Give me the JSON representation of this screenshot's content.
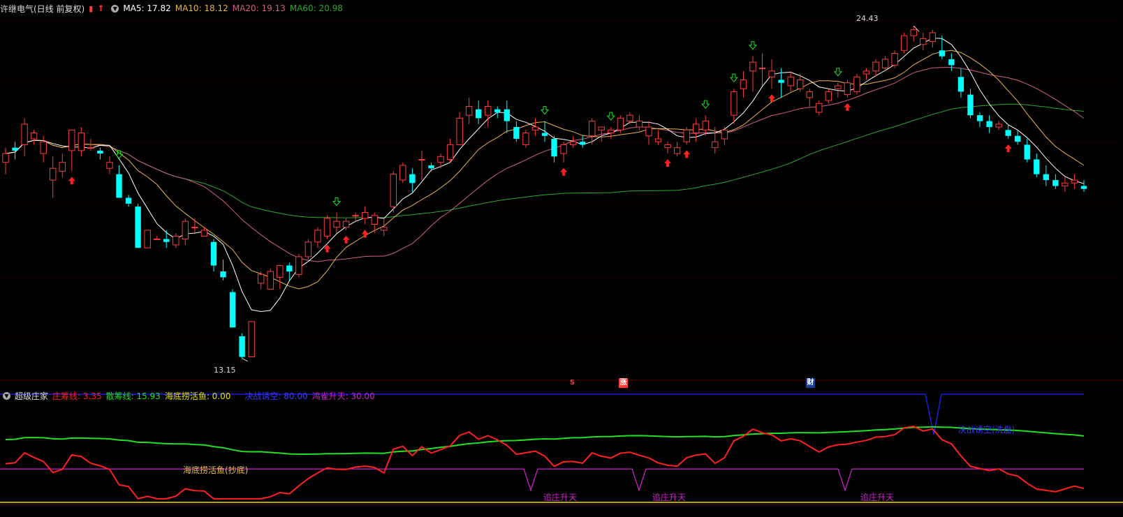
{
  "stock_header": {
    "title": "许继电气(日线 前复权)",
    "ma5": "MA5: 17.82",
    "ma10": "MA10: 18.12",
    "ma20": "MA20: 19.13",
    "ma60": "MA60: 20.98"
  },
  "indicator_header": {
    "name": "超级庄家",
    "zhuang": "庄筹线: 3.35",
    "san": "散筹线: 15.93",
    "haidi": "海底捞活鱼: 0.00",
    "juezhan": "决战诱空: 80.00",
    "hongque": "鸿雀升天: 30.00"
  },
  "markers": {
    "s": "S",
    "zhang": "涨",
    "cai": "财"
  },
  "annotations": {
    "high_label": "24.43",
    "low_label": "13.15",
    "haidi_text": "海底捞活鱼(抄底)",
    "juezhan_text": "决战诱空(洗盘)",
    "zhuiz_text": "追庄升天"
  },
  "colors": {
    "up": "#ff3b3b",
    "down": "#00ffff",
    "ma5": "#ffffff",
    "ma10": "#e7b54a",
    "ma20": "#d0608a",
    "ma60": "#2aa82a",
    "zhuang": "#ff2020",
    "san": "#22e022",
    "haidi": "#e8e000",
    "juezhan": "#2020ff",
    "hongque": "#cc22cc"
  },
  "chart_data": {
    "type": "candlestick",
    "high": 24.43,
    "low": 13.15,
    "ohlc": [
      [
        19.8,
        20.3,
        19.4,
        20.1
      ],
      [
        20.3,
        20.5,
        19.9,
        20.2
      ],
      [
        20.4,
        21.3,
        20.0,
        21.1
      ],
      [
        20.6,
        20.9,
        20.4,
        20.8
      ],
      [
        20.1,
        20.7,
        19.8,
        20.5
      ],
      [
        19.2,
        20.0,
        18.6,
        19.6
      ],
      [
        19.5,
        20.1,
        19.3,
        19.8
      ],
      [
        20.2,
        20.9,
        19.5,
        20.9
      ],
      [
        20.2,
        21.0,
        20.0,
        20.8
      ],
      [
        20.3,
        20.6,
        20.2,
        20.3
      ],
      [
        20.2,
        20.3,
        19.9,
        20.1
      ],
      [
        19.6,
        20.0,
        19.4,
        19.8
      ],
      [
        19.4,
        19.7,
        18.6,
        18.6
      ],
      [
        18.6,
        18.7,
        18.3,
        18.4
      ],
      [
        18.3,
        18.4,
        16.9,
        16.9
      ],
      [
        16.9,
        17.5,
        16.9,
        17.5
      ],
      [
        17.2,
        17.3,
        17.2,
        17.2
      ],
      [
        17.2,
        17.5,
        16.9,
        17.1
      ],
      [
        17.0,
        17.4,
        16.9,
        17.3
      ],
      [
        17.2,
        17.9,
        17.0,
        17.8
      ],
      [
        17.6,
        17.9,
        17.4,
        17.6
      ],
      [
        17.3,
        17.6,
        17.3,
        17.5
      ],
      [
        17.1,
        17.2,
        16.1,
        16.3
      ],
      [
        16.1,
        16.5,
        15.8,
        15.9
      ],
      [
        15.4,
        15.5,
        14.2,
        14.2
      ],
      [
        13.9,
        14.0,
        13.15,
        13.2
      ],
      [
        13.2,
        14.4,
        13.2,
        14.4
      ],
      [
        15.7,
        16.1,
        15.5,
        16.0
      ],
      [
        15.5,
        16.2,
        15.5,
        16.1
      ],
      [
        15.9,
        16.3,
        15.5,
        16.3
      ],
      [
        16.3,
        16.4,
        15.8,
        16.1
      ],
      [
        16.0,
        16.7,
        15.9,
        16.6
      ],
      [
        16.6,
        17.2,
        16.5,
        17.1
      ],
      [
        17.1,
        17.6,
        16.9,
        17.5
      ],
      [
        17.3,
        18.0,
        17.2,
        17.9
      ],
      [
        17.6,
        18.1,
        17.4,
        17.8
      ],
      [
        17.6,
        17.9,
        17.5,
        17.8
      ],
      [
        18.0,
        18.1,
        17.8,
        18.0
      ],
      [
        17.9,
        18.3,
        17.7,
        18.1
      ],
      [
        17.7,
        18.1,
        17.4,
        18.0
      ],
      [
        17.5,
        17.9,
        17.3,
        17.6
      ],
      [
        18.3,
        19.5,
        18.1,
        19.4
      ],
      [
        19.2,
        19.8,
        19.1,
        19.7
      ],
      [
        19.4,
        19.6,
        18.8,
        19.1
      ],
      [
        19.9,
        20.2,
        19.2,
        19.9
      ],
      [
        19.7,
        19.8,
        19.5,
        19.6
      ],
      [
        19.8,
        20.1,
        19.6,
        20.0
      ],
      [
        19.9,
        20.6,
        19.8,
        20.4
      ],
      [
        20.4,
        21.5,
        20.4,
        21.3
      ],
      [
        21.4,
        22.0,
        21.1,
        21.7
      ],
      [
        21.6,
        21.9,
        21.1,
        21.3
      ],
      [
        21.4,
        21.9,
        21.0,
        21.7
      ],
      [
        21.6,
        21.7,
        21.3,
        21.5
      ],
      [
        21.6,
        21.9,
        20.8,
        21.2
      ],
      [
        21.0,
        21.2,
        20.5,
        20.6
      ],
      [
        20.4,
        20.9,
        20.3,
        20.8
      ],
      [
        20.9,
        21.3,
        20.7,
        21.0
      ],
      [
        20.8,
        21.2,
        20.5,
        20.7
      ],
      [
        20.6,
        20.7,
        19.8,
        20.0
      ],
      [
        20.1,
        20.5,
        19.8,
        20.4
      ],
      [
        20.4,
        20.7,
        20.3,
        20.5
      ],
      [
        20.5,
        20.7,
        20.3,
        20.4
      ],
      [
        20.7,
        21.3,
        20.4,
        21.2
      ],
      [
        20.9,
        21.0,
        20.5,
        21.0
      ],
      [
        20.8,
        21.0,
        20.6,
        20.9
      ],
      [
        20.9,
        21.4,
        20.8,
        21.3
      ],
      [
        21.2,
        21.5,
        21.1,
        21.4
      ],
      [
        21.0,
        21.4,
        20.9,
        21.2
      ],
      [
        20.7,
        21.2,
        20.4,
        21.0
      ],
      [
        20.5,
        20.9,
        20.4,
        20.6
      ],
      [
        20.3,
        20.5,
        20.1,
        20.4
      ],
      [
        20.1,
        20.5,
        20.0,
        20.3
      ],
      [
        20.5,
        21.0,
        20.4,
        20.9
      ],
      [
        20.8,
        21.3,
        20.5,
        21.1
      ],
      [
        20.9,
        21.4,
        20.7,
        21.2
      ],
      [
        20.3,
        21.0,
        20.1,
        20.5
      ],
      [
        20.6,
        21.0,
        20.4,
        20.9
      ],
      [
        21.4,
        22.3,
        21.1,
        22.2
      ],
      [
        22.3,
        22.9,
        22.0,
        22.6
      ],
      [
        22.9,
        23.4,
        22.2,
        23.2
      ],
      [
        23.0,
        23.5,
        22.4,
        23.0
      ],
      [
        22.7,
        23.3,
        22.3,
        22.9
      ],
      [
        22.6,
        23.0,
        22.0,
        22.5
      ],
      [
        22.4,
        22.9,
        22.2,
        22.7
      ],
      [
        22.3,
        22.8,
        22.2,
        22.6
      ],
      [
        22.0,
        22.3,
        21.7,
        22.2
      ],
      [
        21.5,
        21.9,
        21.4,
        21.8
      ],
      [
        21.9,
        22.3,
        21.8,
        22.2
      ],
      [
        22.3,
        22.5,
        22.0,
        22.4
      ],
      [
        22.1,
        22.6,
        22.0,
        22.5
      ],
      [
        22.2,
        22.8,
        22.1,
        22.7
      ],
      [
        22.8,
        23.0,
        22.6,
        22.9
      ],
      [
        22.9,
        23.3,
        22.7,
        23.2
      ],
      [
        23.0,
        23.4,
        22.9,
        23.3
      ],
      [
        23.1,
        23.6,
        23.0,
        23.5
      ],
      [
        23.6,
        24.2,
        23.5,
        24.1
      ],
      [
        24.1,
        24.43,
        23.9,
        24.3
      ],
      [
        23.8,
        24.2,
        23.6,
        24.0
      ],
      [
        23.9,
        24.3,
        23.7,
        24.2
      ],
      [
        23.6,
        24.1,
        23.3,
        23.4
      ],
      [
        23.3,
        23.5,
        22.9,
        23.1
      ],
      [
        22.7,
        23.0,
        22.0,
        22.2
      ],
      [
        22.1,
        22.3,
        21.3,
        21.4
      ],
      [
        21.4,
        21.5,
        21.0,
        21.2
      ],
      [
        21.2,
        21.4,
        20.8,
        21.0
      ],
      [
        21.0,
        21.2,
        20.9,
        21.1
      ],
      [
        20.9,
        21.1,
        20.6,
        20.7
      ],
      [
        20.7,
        20.9,
        20.4,
        20.5
      ],
      [
        20.4,
        20.6,
        19.8,
        19.9
      ],
      [
        19.9,
        20.1,
        19.3,
        19.4
      ],
      [
        19.4,
        19.7,
        19.0,
        19.2
      ],
      [
        19.2,
        19.4,
        18.9,
        19.0
      ],
      [
        19.0,
        19.3,
        18.8,
        19.1
      ],
      [
        19.1,
        19.4,
        18.9,
        19.2
      ],
      [
        19.0,
        19.2,
        18.8,
        18.9
      ]
    ],
    "ma_note": "Moving averages MA5/MA10/MA20/MA60 computed from ohlc closes"
  }
}
